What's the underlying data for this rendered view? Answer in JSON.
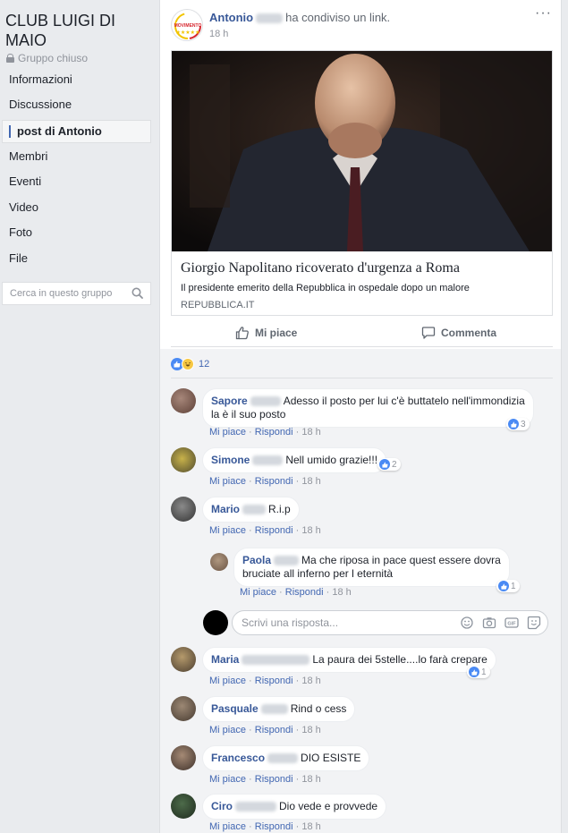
{
  "group": {
    "title": "CLUB LUIGI DI MAIO",
    "status": "Gruppo chiuso",
    "nav": [
      {
        "label": "Informazioni"
      },
      {
        "label": "Discussione"
      },
      {
        "label": "post di Antonio"
      },
      {
        "label": "Membri"
      },
      {
        "label": "Eventi"
      },
      {
        "label": "Video"
      },
      {
        "label": "Foto"
      },
      {
        "label": "File"
      }
    ],
    "active_nav": "post di Antonio",
    "search_placeholder": "Cerca in questo gruppo"
  },
  "post": {
    "author": "Antonio",
    "action": "ha condiviso un link.",
    "time": "18 h",
    "avatar_logo_text": "MOVIMENTO",
    "link": {
      "title": "Giorgio Napolitano ricoverato d'urgenza a Roma",
      "description": "Il presidente emerito della Repubblica in ospedale dopo un malore",
      "domain": "REPUBBLICA.IT"
    },
    "like_label": "Mi piace",
    "comment_label": "Commenta",
    "reaction_count": "12"
  },
  "comment_actions": {
    "like": "Mi piace",
    "reply": "Rispondi"
  },
  "comments": [
    {
      "name": "Sapore",
      "lines": [
        "Adesso il posto per lui c'è buttatelo nell'immondizia",
        "la è il suo posto"
      ],
      "time": "18 h",
      "likes": "3"
    },
    {
      "name": "Simone",
      "lines": [
        "Nell umido grazie!!!"
      ],
      "time": "18 h",
      "likes": "2"
    },
    {
      "name": "Mario",
      "lines": [
        "R.i.p"
      ],
      "time": "18 h",
      "likes": ""
    },
    {
      "name": "Paola",
      "lines": [
        "Ma che riposa in pace quest essere dovra",
        "bruciate all inferno per l eternità"
      ],
      "time": "18 h",
      "likes": "1"
    },
    {
      "name": "Maria",
      "lines": [
        "La paura dei 5stelle....lo farà crepare"
      ],
      "time": "18 h",
      "likes": "1"
    },
    {
      "name": "Pasquale",
      "lines": [
        "Rind o cess"
      ],
      "time": "18 h",
      "likes": ""
    },
    {
      "name": "Francesco",
      "lines": [
        "DIO ESISTE"
      ],
      "time": "18 h",
      "likes": ""
    },
    {
      "name": "Ciro",
      "lines": [
        "Dio vede e provvede"
      ],
      "time": "18 h",
      "likes": ""
    }
  ],
  "reply_placeholder": "Scrivi una risposta...",
  "colors": {
    "link_blue": "#385898",
    "accent": "#4267b2",
    "like_blue": "#4a8af4"
  }
}
